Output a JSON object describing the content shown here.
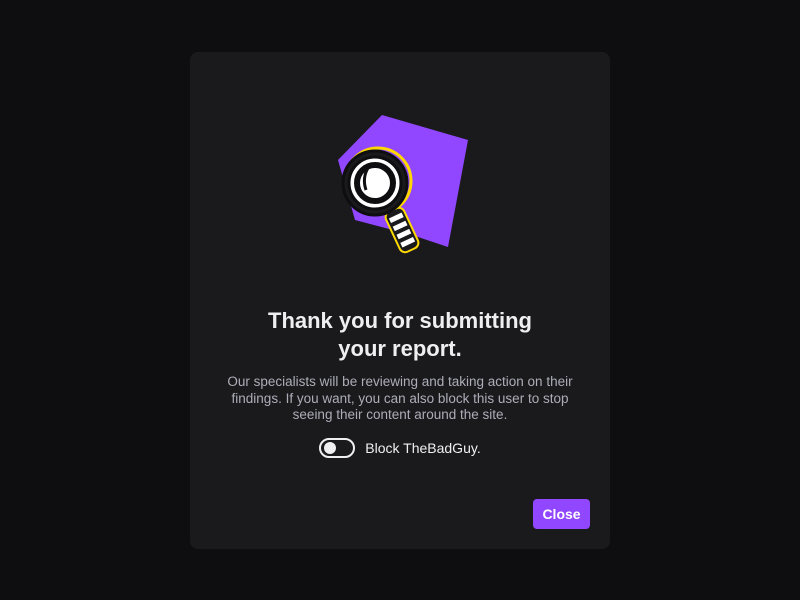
{
  "modal": {
    "title_line1": "Thank you for submitting",
    "title_line2": "your report.",
    "description": "Our specialists will be reviewing and taking action on their findings.  If you want, you can also block this user to stop seeing their content around the site.",
    "block_toggle": {
      "label": "Block TheBadGuy.",
      "checked": false
    },
    "close_label": "Close",
    "illustration_icon": "magnifying-glass-icon"
  },
  "colors": {
    "background": "#0e0e10",
    "modal_background": "#1a1a1d",
    "accent": "#9147ff",
    "text_primary": "#efeff1",
    "text_secondary": "#adadb8"
  }
}
